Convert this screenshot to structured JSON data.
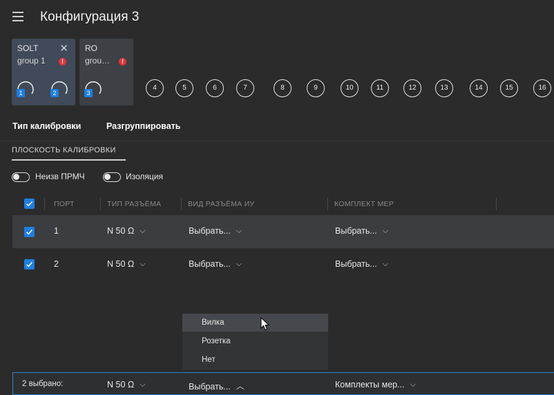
{
  "window": {
    "title": "Конфигурация 3"
  },
  "groups": [
    {
      "type": "SOLT",
      "name": "group 1",
      "close": "✕",
      "warning": "!",
      "ports": [
        "1",
        "2"
      ]
    },
    {
      "type": "RO",
      "name": "grou…",
      "warning": "!",
      "ports": [
        "3"
      ]
    }
  ],
  "free_ports": [
    "4",
    "5",
    "6",
    "7",
    "8",
    "9",
    "10",
    "11",
    "12",
    "13",
    "14",
    "15",
    "16"
  ],
  "toolbar": {
    "cal_type": "Тип калибровки",
    "ungroup": "Разгруппировать"
  },
  "tabs": {
    "plane": "ПЛОСКОСТЬ КАЛИБРОВКИ"
  },
  "toggles": [
    {
      "label": "Неизв ПРМЧ",
      "on": false
    },
    {
      "label": "Изоляция",
      "on": false
    }
  ],
  "table": {
    "headers": {
      "port": "ПОРТ",
      "connector": "ТИП РАЗЪЁМА",
      "gender": "ВИД РАЗЪЁМА ИУ",
      "kit": "КОМПЛЕКТ МЕР"
    },
    "rows": [
      {
        "checked": true,
        "port": "1",
        "connector": "N 50 Ω",
        "gender": "Выбрать...",
        "kit": "Выбрать..."
      },
      {
        "checked": true,
        "port": "2",
        "connector": "N 50 Ω",
        "gender": "Выбрать...",
        "kit": "Выбрать..."
      }
    ]
  },
  "dropdown_menu": {
    "items": [
      "Вилка",
      "Розетка",
      "Нет"
    ],
    "highlighted": "Вилка"
  },
  "bulk_edit": {
    "count": "2 выбрано:",
    "connector": "N 50 Ω",
    "gender": "Выбрать...",
    "kit": "Комплекты мер..."
  },
  "colors": {
    "accent": "#1e7fe0",
    "warning": "#e0363a",
    "background": "#2b2b2b"
  }
}
